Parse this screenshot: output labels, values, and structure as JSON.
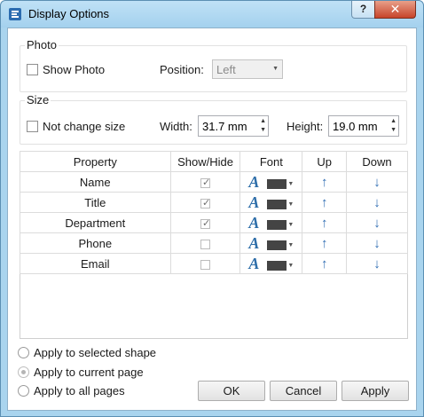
{
  "window": {
    "title": "Display Options",
    "help_label": "?",
    "close_label": "✕"
  },
  "photo": {
    "group_label": "Photo",
    "show_photo_label": "Show Photo",
    "show_photo_checked": false,
    "position_label": "Position:",
    "position_value": "Left"
  },
  "size": {
    "group_label": "Size",
    "not_change_label": "Not change size",
    "not_change_checked": false,
    "width_label": "Width:",
    "width_value": "31.7 mm",
    "height_label": "Height:",
    "height_value": "19.0 mm"
  },
  "table": {
    "headers": [
      "Property",
      "Show/Hide",
      "Font",
      "Up",
      "Down"
    ],
    "rows": [
      {
        "property": "Name",
        "show": true
      },
      {
        "property": "Title",
        "show": true
      },
      {
        "property": "Department",
        "show": true
      },
      {
        "property": "Phone",
        "show": false
      },
      {
        "property": "Email",
        "show": false
      }
    ],
    "font_glyph": "A",
    "up_glyph": "🡑",
    "down_glyph": "🡓"
  },
  "apply_scope": {
    "options": [
      "Apply to selected shape",
      "Apply to current page",
      "Apply to all pages"
    ],
    "selected_index": 1
  },
  "buttons": {
    "ok": "OK",
    "cancel": "Cancel",
    "apply": "Apply"
  },
  "colors": {
    "accent": "#2e6ea9",
    "font_color_swatch": "#444444"
  }
}
